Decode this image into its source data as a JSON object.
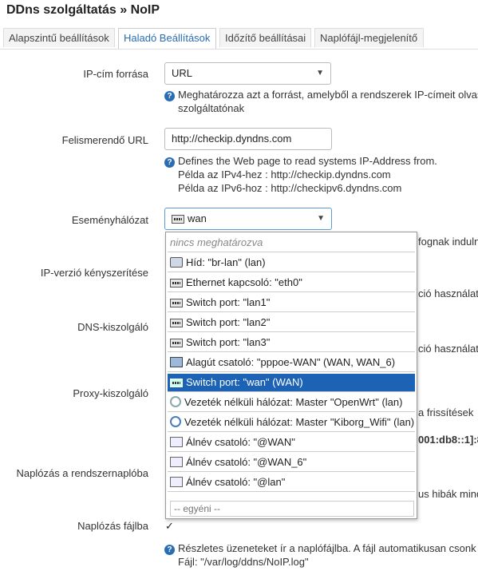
{
  "page": {
    "title": "DDns szolgáltatás » NoIP"
  },
  "tabs": [
    {
      "label": "Alapszintű beállítások"
    },
    {
      "label": "Haladó Beállítások"
    },
    {
      "label": "Időzítő beállításai"
    },
    {
      "label": "Naplófájl-megjelenítő"
    }
  ],
  "ip_source": {
    "label": "IP-cím forrása",
    "value": "URL",
    "help_1": "Meghatározza azt a forrást, amelyből a rendszerek IP-címeit olvas",
    "help_2": "szolgáltatónak"
  },
  "detect_url": {
    "label": "Felismerendő URL",
    "value": "http://checkip.dyndns.com",
    "help_1": "Defines the Web page to read systems IP-Address from.",
    "help_2": "Példa az IPv4-hez : http://checkip.dyndns.com",
    "help_3": "Példa az IPv6-hoz : http://checkipv6.dyndns.com"
  },
  "event_network": {
    "label": "Eseményhálózat",
    "value": "wan",
    "behind_text": "fognak indulni",
    "options": [
      {
        "label": "nincs meghatározva",
        "icon": "none"
      },
      {
        "label": "Híd: \"br-lan\" (lan)",
        "icon": "bridge-icon"
      },
      {
        "label": "Ethernet kapcsoló: \"eth0\"",
        "icon": "ethernet-switch-icon"
      },
      {
        "label": "Switch port: \"lan1\"",
        "icon": "switch-port-icon"
      },
      {
        "label": "Switch port: \"lan2\"",
        "icon": "switch-port-icon"
      },
      {
        "label": "Switch port: \"lan3\"",
        "icon": "switch-port-icon"
      },
      {
        "label": "Alagút csatoló: \"pppoe-WAN\" (WAN, WAN_6)",
        "icon": "tunnel-icon"
      },
      {
        "label": "Switch port: \"wan\" (WAN)",
        "icon": "switch-port-icon"
      },
      {
        "label": "Vezeték nélküli hálózat: Master \"OpenWrt\" (lan)",
        "icon": "wireless-disabled-icon"
      },
      {
        "label": "Vezeték nélküli hálózat: Master \"Kiborg_Wifi\" (lan)",
        "icon": "wireless-icon"
      },
      {
        "label": "Álnév csatoló: \"@WAN\"",
        "icon": "alias-icon"
      },
      {
        "label": "Álnév csatoló: \"@WAN_6\"",
        "icon": "alias-icon"
      },
      {
        "label": "Álnév csatoló: \"@lan\"",
        "icon": "alias-icon"
      }
    ],
    "custom_placeholder": "-- egyéni --"
  },
  "ip_version": {
    "label": "IP-verzió kényszerítése",
    "behind_text": "ció használata"
  },
  "dns_server": {
    "label": "DNS-kiszolgáló",
    "behind_text": "ció használata"
  },
  "proxy": {
    "label": "Proxy-kiszolgáló",
    "behind_text_1": "a frissítések",
    "behind_text_2": "001:db8::1]:8"
  },
  "syslog": {
    "label": "Naplózás a rendszernaplóba",
    "behind_text": "us hibák mind"
  },
  "logfile": {
    "label": "Naplózás fájlba",
    "checked": true,
    "check_glyph": "✓",
    "help_1": "Részletes üzeneteket ír a naplófájlba. A fájl automatikusan csonk",
    "help_2": "Fájl: \"/var/log/ddns/NoIP.log\""
  },
  "help_glyph": "?",
  "colors": {
    "accent": "#2a6db3",
    "selected": "#1c63b5"
  }
}
